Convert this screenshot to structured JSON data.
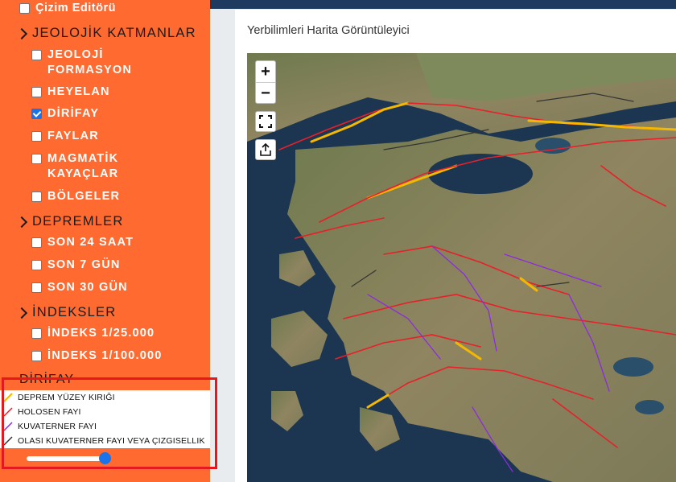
{
  "sidebar": {
    "drawing_editor": "Çizim Editörü",
    "geology_section": "JEOLOJİK KATMANLAR",
    "geology_items": [
      {
        "label_line1": "JEOLOJİ",
        "label_line2": "FORMASYON",
        "checked": false
      },
      {
        "label": "HEYELAN",
        "checked": false
      },
      {
        "label": "DİRİFAY",
        "checked": true
      },
      {
        "label": "FAYLAR",
        "checked": false
      },
      {
        "label_line1": "MAGMATİK",
        "label_line2": "KAYAÇLAR",
        "checked": false
      },
      {
        "label": "BÖLGELER",
        "checked": false
      }
    ],
    "earthquake_section": "DEPREMLER",
    "earthquake_items": [
      {
        "label": "SON 24 SAAT",
        "checked": false
      },
      {
        "label": "SON 7 GÜN",
        "checked": false
      },
      {
        "label": "SON 30 GÜN",
        "checked": false
      }
    ],
    "index_section": "İNDEKSLER",
    "index_items": [
      {
        "label": "İNDEKS 1/25.000",
        "checked": false
      },
      {
        "label": "İNDEKS 1/100.000",
        "checked": false
      }
    ]
  },
  "legend": {
    "title": "DİRİFAY",
    "items": [
      {
        "label": "DEPREM YÜZEY KIRIĞI",
        "color": "#f5b800"
      },
      {
        "label": "HOLOSEN FAYI",
        "color": "#e8202a"
      },
      {
        "label": "KUVATERNER FAYI",
        "color": "#8a2be2"
      },
      {
        "label": "OLASI KUVATERNER FAYI VEYA ÇIZGISELLIK",
        "color": "#333333"
      }
    ],
    "opacity_value": 1.0
  },
  "map": {
    "title": "Yerbilimleri Harita Görüntüleyici",
    "zoom_in": "+",
    "zoom_out": "−"
  },
  "colors": {
    "sidebar_bg": "#ff6a30",
    "accent": "#1a73e8",
    "highlight": "#e5181d"
  }
}
